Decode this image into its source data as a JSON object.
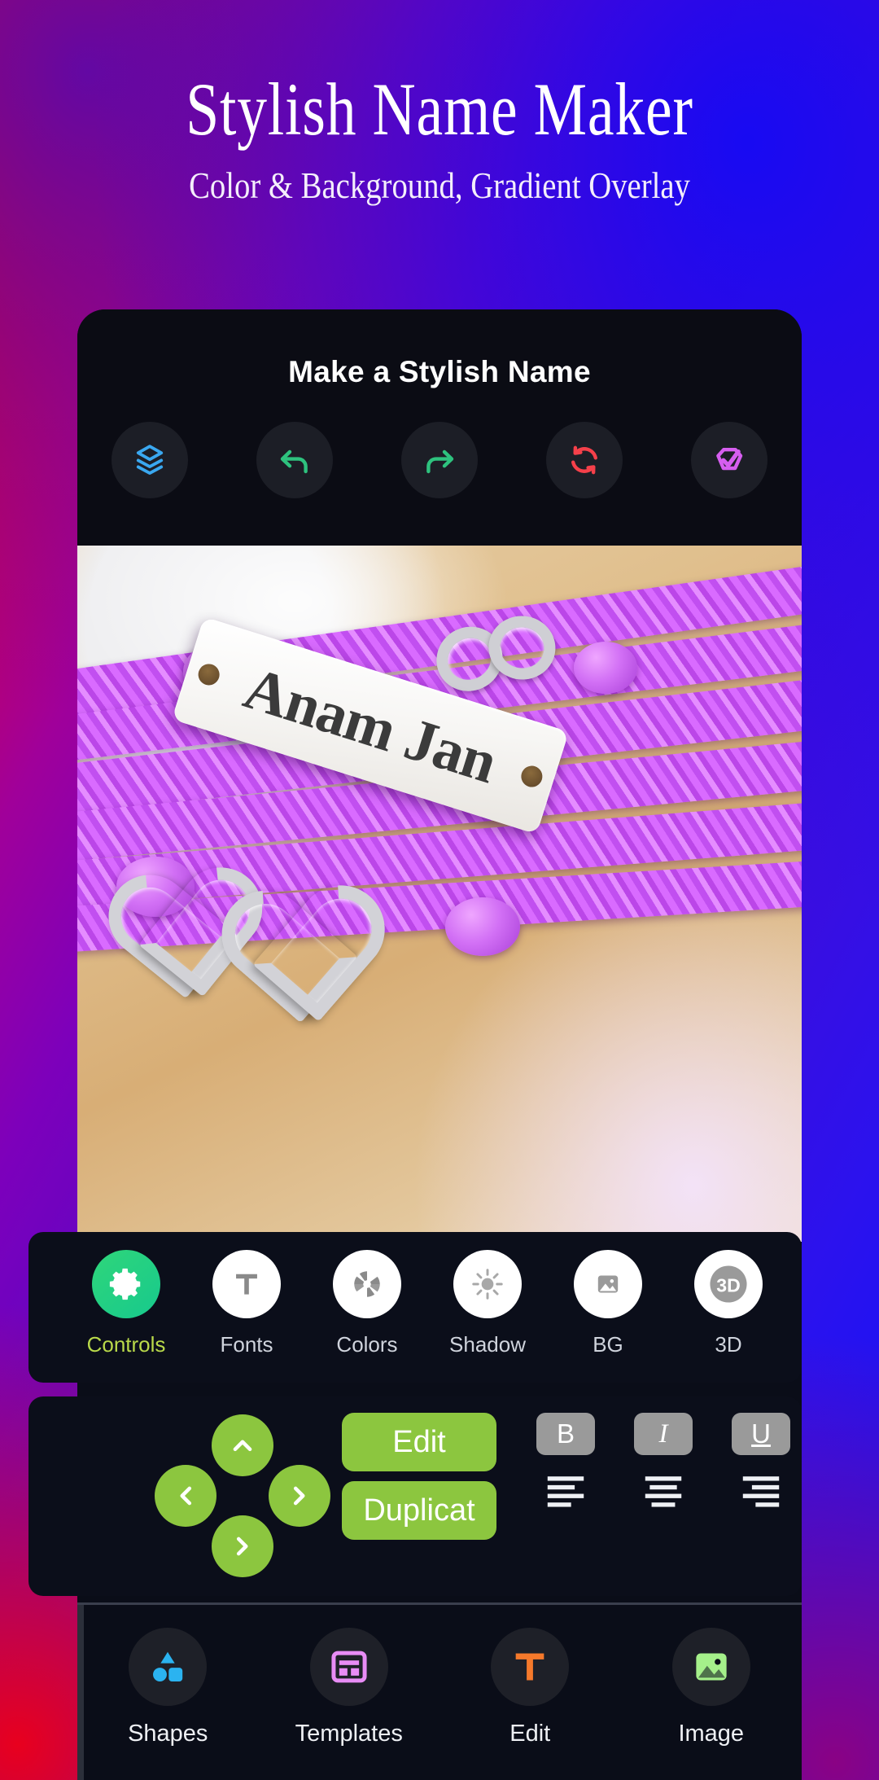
{
  "promo": {
    "title": "Stylish Name Maker",
    "subtitle": "Color & Background, Gradient Overlay",
    "bg_start": "#e8001e",
    "bg_end": "#1a13f5"
  },
  "app": {
    "header_title": "Make a Stylish Name",
    "toolbar": [
      {
        "name": "layers-icon",
        "color": "#3aa8f0"
      },
      {
        "name": "undo-icon",
        "color": "#2ec27e"
      },
      {
        "name": "redo-icon",
        "color": "#2ec27e"
      },
      {
        "name": "reset-icon",
        "color": "#f5404a"
      },
      {
        "name": "done-check-icon",
        "color": "#d65ef0"
      }
    ]
  },
  "canvas": {
    "name_text": "Anam Jan",
    "name_color": "#3b3b3b",
    "cord_color": "#d96bff",
    "plate_color": "#ffffff"
  },
  "tools": [
    {
      "label": "Controls",
      "icon": "gear-icon",
      "active": true,
      "icon_color": "#ffffff",
      "bg": "#2fd67a"
    },
    {
      "label": "Fonts",
      "icon": "text-t-icon",
      "active": false,
      "icon_color": "#8a8a8a",
      "bg": "#ffffff"
    },
    {
      "label": "Colors",
      "icon": "color-wheel-icon",
      "active": false,
      "icon_color": "#8a8a8a",
      "bg": "#ffffff"
    },
    {
      "label": "Shadow",
      "icon": "sun-icon",
      "active": false,
      "icon_color": "#a8a8a8",
      "bg": "#ffffff"
    },
    {
      "label": "BG",
      "icon": "image-icon",
      "active": false,
      "icon_color": "#9a9a9a",
      "bg": "#ffffff"
    },
    {
      "label": "3D",
      "icon": "three-d-icon",
      "active": false,
      "icon_color": "#9a9a9a",
      "bg": "#ffffff"
    }
  ],
  "controls": {
    "dpad": {
      "up": "chevron-up-icon",
      "left": "chevron-left-icon",
      "right": "chevron-right-icon",
      "down": "chevron-right-icon"
    },
    "edit_label": "Edit",
    "duplicate_label": "Duplicat",
    "button_color": "#8cc63f",
    "styles": [
      {
        "label": "B",
        "name": "bold-button"
      },
      {
        "label": "I",
        "name": "italic-button"
      },
      {
        "label": "U",
        "name": "underline-button"
      }
    ],
    "aligns": [
      {
        "name": "align-left-icon"
      },
      {
        "name": "align-center-icon"
      },
      {
        "name": "align-right-icon"
      }
    ]
  },
  "bottom_nav": [
    {
      "label": "Shapes",
      "icon": "shapes-icon",
      "color": "#2bb3f0"
    },
    {
      "label": "Templates",
      "icon": "template-icon",
      "color": "#e88cf5"
    },
    {
      "label": "Edit",
      "icon": "text-t-icon",
      "color": "#f5792b"
    },
    {
      "label": "Image",
      "icon": "image-icon",
      "color": "#a5f08a"
    }
  ]
}
